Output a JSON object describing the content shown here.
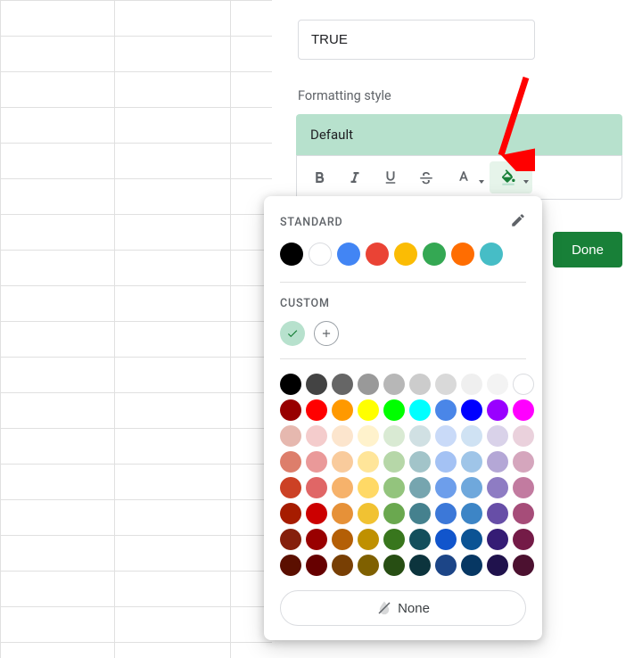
{
  "input_value": "TRUE",
  "section_label": "Formatting style",
  "preview_text": "Default",
  "done_label": "Done",
  "popup": {
    "standard_label": "STANDARD",
    "custom_label": "CUSTOM",
    "none_label": "None",
    "standard_colors": [
      "#000000",
      "#ffffff",
      "#4285f4",
      "#ea4335",
      "#fbbc04",
      "#34a853",
      "#ff6d01",
      "#46bdc6"
    ],
    "custom_colors": [
      "#b7e1cd"
    ],
    "palette": [
      [
        "#000000",
        "#434343",
        "#666666",
        "#999999",
        "#b7b7b7",
        "#cccccc",
        "#d9d9d9",
        "#efefef",
        "#f3f3f3",
        "#ffffff"
      ],
      [
        "#980000",
        "#ff0000",
        "#ff9900",
        "#ffff00",
        "#00ff00",
        "#00ffff",
        "#4a86e8",
        "#0000ff",
        "#9900ff",
        "#ff00ff"
      ],
      [
        "#e6b8af",
        "#f4cccc",
        "#fce5cd",
        "#fff2cc",
        "#d9ead3",
        "#d0e0e3",
        "#c9daf8",
        "#cfe2f3",
        "#d9d2e9",
        "#ead1dc"
      ],
      [
        "#dd7e6b",
        "#ea9999",
        "#f9cb9c",
        "#ffe599",
        "#b6d7a8",
        "#a2c4c9",
        "#a4c2f4",
        "#9fc5e8",
        "#b4a7d6",
        "#d5a6bd"
      ],
      [
        "#cc4125",
        "#e06666",
        "#f6b26b",
        "#ffd966",
        "#93c47d",
        "#76a5af",
        "#6d9eeb",
        "#6fa8dc",
        "#8e7cc3",
        "#c27ba0"
      ],
      [
        "#a61c00",
        "#cc0000",
        "#e69138",
        "#f1c232",
        "#6aa84f",
        "#45818e",
        "#3c78d8",
        "#3d85c6",
        "#674ea7",
        "#a64d79"
      ],
      [
        "#85200c",
        "#990000",
        "#b45f06",
        "#bf9000",
        "#38761d",
        "#134f5c",
        "#1155cc",
        "#0b5394",
        "#351c75",
        "#741b47"
      ],
      [
        "#5b0f00",
        "#660000",
        "#783f04",
        "#7f6000",
        "#274e13",
        "#0c343d",
        "#1c4587",
        "#073763",
        "#20124d",
        "#4c1130"
      ]
    ]
  }
}
